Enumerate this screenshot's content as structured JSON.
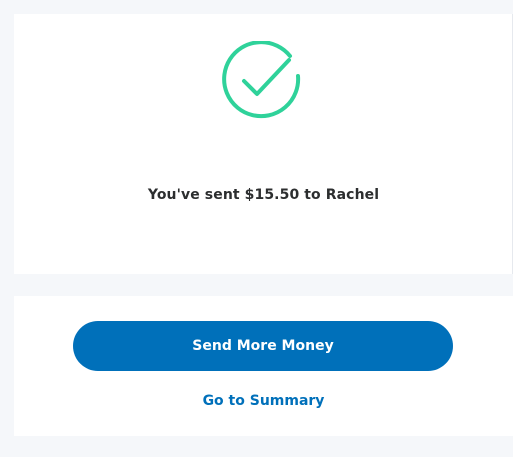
{
  "confirmation": {
    "icon": "checkmark-circle-icon",
    "message": "You've sent $15.50 to Rachel"
  },
  "actions": {
    "send_more_label": "Send More Money",
    "summary_label": "Go to Summary"
  },
  "colors": {
    "accent": "#0070ba",
    "success": "#2fd29a",
    "text": "#2c2e2f",
    "background": "#f5f7fa"
  }
}
